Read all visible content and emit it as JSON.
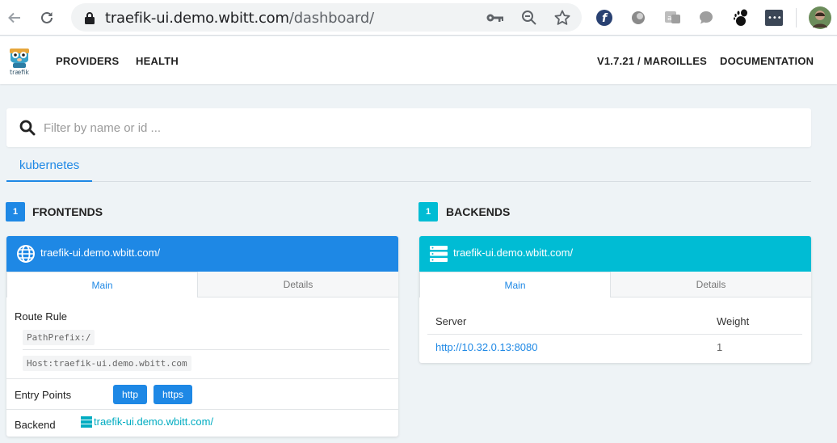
{
  "browser": {
    "url_host": "traefik-ui.demo.wbitt.com",
    "url_path": "/dashboard/"
  },
  "app": {
    "logo_text": "træfik",
    "nav": {
      "providers": "PROVIDERS",
      "health": "HEALTH",
      "version": "V1.7.21 / MAROILLES",
      "documentation": "DOCUMENTATION"
    },
    "search": {
      "placeholder": "Filter by name or id ..."
    },
    "provider_tabs": [
      "kubernetes"
    ],
    "colors": {
      "frontend": "#1e88e5",
      "backend": "#00bcd4"
    }
  },
  "frontends": {
    "count": "1",
    "title": "FRONTENDS",
    "card": {
      "name": "traefik-ui.demo.wbitt.com/",
      "tabs": [
        "Main",
        "Details"
      ],
      "route_rule_label": "Route Rule",
      "route_rules": [
        "PathPrefix:/",
        "Host:traefik-ui.demo.wbitt.com"
      ],
      "entry_points_label": "Entry Points",
      "entry_points": [
        "http",
        "https"
      ],
      "backend_label": "Backend",
      "backend_value": "traefik-ui.demo.wbitt.com/"
    }
  },
  "backends": {
    "count": "1",
    "title": "BACKENDS",
    "card": {
      "name": "traefik-ui.demo.wbitt.com/",
      "tabs": [
        "Main",
        "Details"
      ],
      "columns": [
        "Server",
        "Weight"
      ],
      "rows": [
        {
          "server": "http://10.32.0.13:8080",
          "weight": "1"
        }
      ]
    }
  }
}
